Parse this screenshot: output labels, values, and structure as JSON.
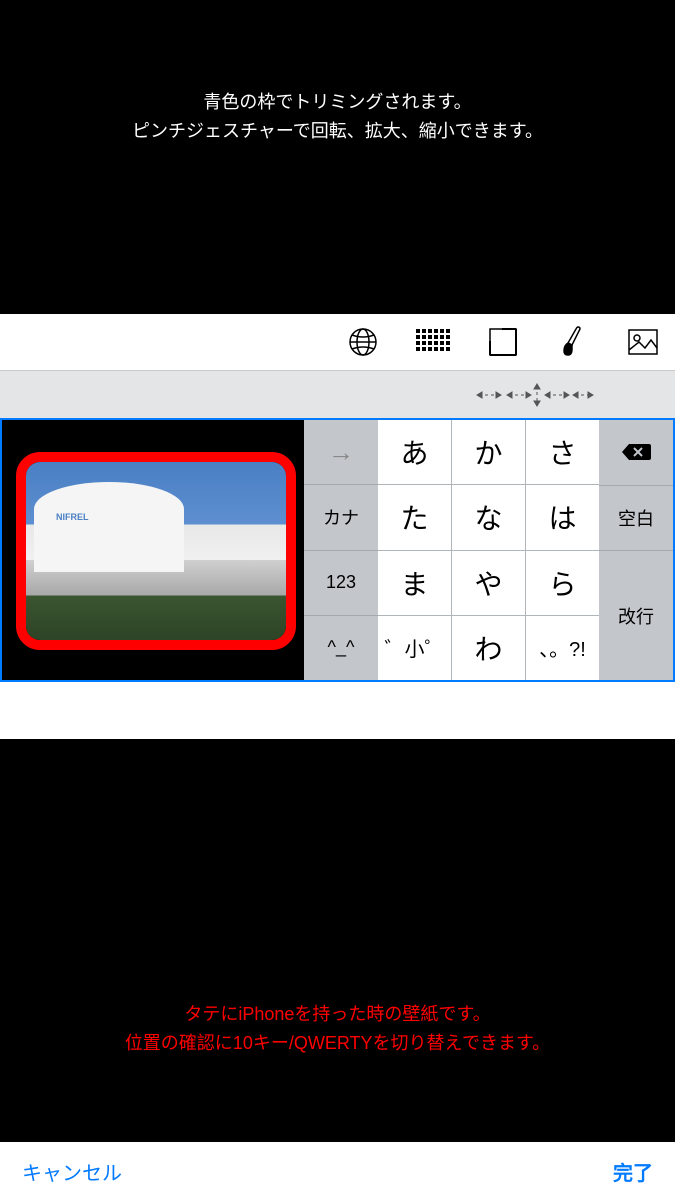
{
  "instructions": {
    "top_line1": "青色の枠でトリミングされます。",
    "top_line2": "ピンチジェスチャーで回転、拡大、縮小できます。",
    "bottom_line1": "タテにiPhoneを持った時の壁紙です。",
    "bottom_line2": "位置の確認に10キー/QWERTYを切り替えできます。"
  },
  "toolbar": {
    "globe": "globe",
    "grid": "grid",
    "crop": "crop",
    "brush": "brush",
    "image": "image"
  },
  "photo": {
    "sign": "NIFREL"
  },
  "keyboard": {
    "left": {
      "arrow": "→",
      "kana": "カナ",
      "numbers": "123",
      "emoji": "^_^"
    },
    "center": [
      [
        "あ",
        "か",
        "さ"
      ],
      [
        "た",
        "な",
        "は"
      ],
      [
        "ま",
        "や",
        "ら"
      ],
      [
        "゛小゜",
        "わ",
        "、。?!"
      ]
    ],
    "right": {
      "delete": "⌫",
      "space": "空白",
      "return": "改行"
    }
  },
  "bottom_bar": {
    "cancel": "キャンセル",
    "done": "完了"
  }
}
